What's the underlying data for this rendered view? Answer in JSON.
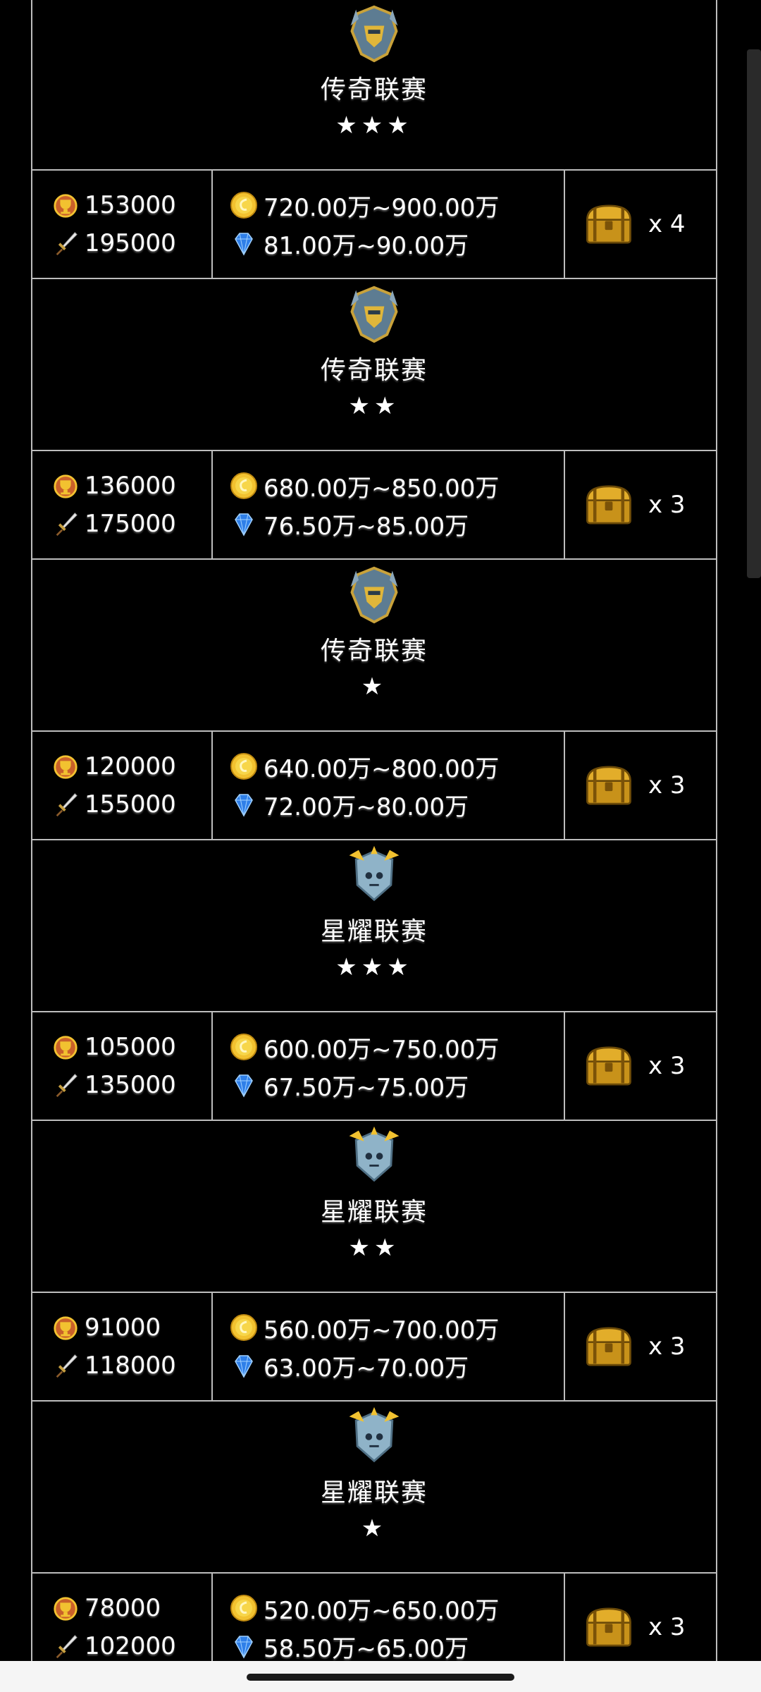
{
  "blocks": [
    {
      "league": {
        "name": "传奇联赛",
        "stars": "★★★",
        "emblem": "legend-emblem-icon"
      },
      "reward": {
        "trophies": "153000",
        "power": "195000",
        "gold": "720.00万~900.00万",
        "gems": "81.00万~90.00万",
        "chest": "x 4"
      }
    },
    {
      "league": {
        "name": "传奇联赛",
        "stars": "★★",
        "emblem": "legend-emblem-icon"
      },
      "reward": {
        "trophies": "136000",
        "power": "175000",
        "gold": "680.00万~850.00万",
        "gems": "76.50万~85.00万",
        "chest": "x 3"
      }
    },
    {
      "league": {
        "name": "传奇联赛",
        "stars": "★",
        "emblem": "legend-emblem-icon"
      },
      "reward": {
        "trophies": "120000",
        "power": "155000",
        "gold": "640.00万~800.00万",
        "gems": "72.00万~80.00万",
        "chest": "x 3"
      }
    },
    {
      "league": {
        "name": "星耀联赛",
        "stars": "★★★",
        "emblem": "star-emblem-icon"
      },
      "reward": {
        "trophies": "105000",
        "power": "135000",
        "gold": "600.00万~750.00万",
        "gems": "67.50万~75.00万",
        "chest": "x 3"
      }
    },
    {
      "league": {
        "name": "星耀联赛",
        "stars": "★★",
        "emblem": "star-emblem-icon"
      },
      "reward": {
        "trophies": "91000",
        "power": "118000",
        "gold": "560.00万~700.00万",
        "gems": "63.00万~70.00万",
        "chest": "x 3"
      }
    },
    {
      "league": {
        "name": "星耀联赛",
        "stars": "★",
        "emblem": "star-emblem-icon"
      },
      "reward": {
        "trophies": "78000",
        "power": "102000",
        "gold": "520.00万~650.00万",
        "gems": "58.50万~65.00万",
        "chest": "x 3"
      }
    }
  ],
  "colors": {
    "background": "#000000",
    "border": "#bdbdbd",
    "gold": "#f2c230",
    "gem": "#2f7fe8",
    "trophy": "#c9602a"
  }
}
